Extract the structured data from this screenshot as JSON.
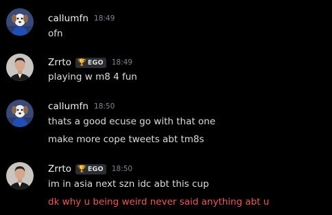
{
  "messages": [
    {
      "author": "callumfn",
      "avatar": "dog-avatar",
      "time": "18:49",
      "tag": null,
      "lines": [
        "ofn"
      ]
    },
    {
      "author": "Zrrto",
      "avatar": "man-avatar",
      "time": "18:49",
      "tag": {
        "icon": "trophy-icon",
        "glyph": "🏆",
        "label": "EGO"
      },
      "lines": [
        "playing w m8 4 fun"
      ]
    },
    {
      "author": "callumfn",
      "avatar": "dog-avatar",
      "time": "18:50",
      "tag": null,
      "lines": [
        "thats a good ecuse go with that one",
        "make more cope tweets abt tm8s"
      ]
    },
    {
      "author": "Zrrto",
      "avatar": "man-avatar",
      "time": "18:50",
      "tag": {
        "icon": "trophy-icon",
        "glyph": "🏆",
        "label": "EGO"
      },
      "lines": [
        "im in asia next szn idc abt this cup",
        "dk why u being weird never said anything abt u"
      ]
    }
  ],
  "colors": {
    "background": "#000000",
    "username": "#f2f3f5",
    "message_text": "#dbdee1",
    "highlight_text": "#f2555a",
    "timestamp": "#80848e",
    "tag_background": "#2b2d31",
    "trophy": "#e7b52c"
  }
}
